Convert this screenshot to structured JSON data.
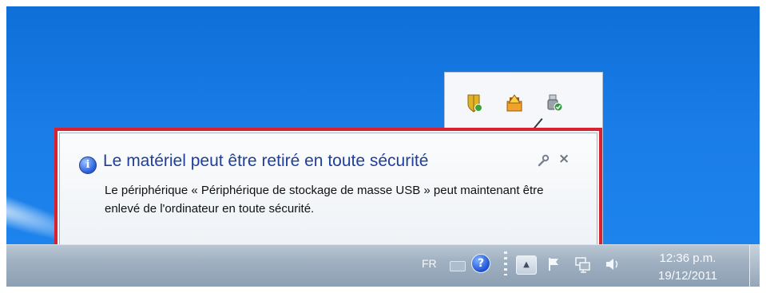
{
  "balloon": {
    "title": "Le matériel peut être retiré en toute sécurité",
    "message": "Le périphérique « Périphérique de stockage de masse USB » peut maintenant être enlevé de l'ordinateur en toute sécurité.",
    "info_icon": "info-icon",
    "settings_icon": "wrench-icon",
    "close_label": "×"
  },
  "overflow_icons": [
    "security-shield-icon",
    "network-warning-icon",
    "usb-safely-remove-icon"
  ],
  "taskbar": {
    "language": "FR",
    "help_label": "?",
    "arrow_label": "▲",
    "clock_time": "12:36 p.m.",
    "clock_date": "19/12/2011"
  },
  "colors": {
    "highlight_border": "#d8222f",
    "desktop": "#1a7de8",
    "title": "#1f3f9a"
  }
}
